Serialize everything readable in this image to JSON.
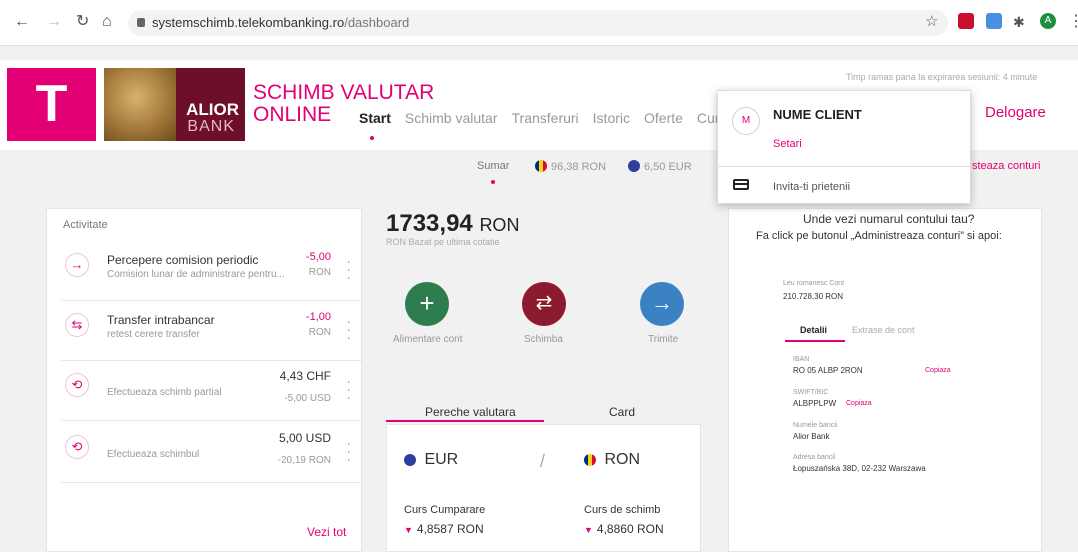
{
  "browser": {
    "url_domain": "systemschimb.telekombanking.ro",
    "url_path": "/dashboard",
    "profile_initial": "A"
  },
  "header": {
    "brand_line1": "SCHIMB VALUTAR",
    "brand_line2": "ONLINE",
    "alior_line1": "ALIOR",
    "alior_line2": "BANK",
    "session_text": "Timp ramas pana la expirarea sesiunii: 4 minute",
    "logout_label": "Delogare",
    "nav": [
      "Start",
      "Schimb valutar",
      "Transferuri",
      "Istoric",
      "Oferte",
      "Curs"
    ]
  },
  "summary": {
    "label": "Sumar",
    "ron": "96,38 RON",
    "eur": "6,50 EUR",
    "manage_link": "steaza conturi"
  },
  "activity": {
    "title": "Activitate",
    "items": [
      {
        "title": "Percepere comision periodic",
        "subtitle": "Comision lunar de administrare pentru...",
        "amount": "-5,00",
        "amount2": "RON",
        "icon": "arrow-right"
      },
      {
        "title": "Transfer intrabancar",
        "subtitle": "retest cerere transfer",
        "amount": "-1,00",
        "amount2": "RON",
        "icon": "transfer"
      },
      {
        "title": "",
        "subtitle": "Efectueaza schimb partial",
        "amount": "4,43 CHF",
        "amount2": "-5,00 USD",
        "icon": "exchange"
      },
      {
        "title": "",
        "subtitle": "Efectueaza schimbul",
        "amount": "5,00 USD",
        "amount2": "-20,19 RON",
        "icon": "exchange"
      }
    ],
    "see_all": "Vezi tot"
  },
  "balance": {
    "integer": "1733,",
    "decimal": "94",
    "currency": "RON",
    "subtitle": "RON Bazat pe ultima cotatie"
  },
  "actions": [
    {
      "label": "Alimentare cont",
      "color": "#2e7d4f",
      "icon": "+"
    },
    {
      "label": "Schimba",
      "color": "#8b1a2f",
      "icon": "⇄"
    },
    {
      "label": "Trimite",
      "color": "#3b82c4",
      "icon": "→"
    }
  ],
  "pair": {
    "tabs": [
      "Pereche valutara",
      "Card"
    ],
    "from": "EUR",
    "to": "RON",
    "separator": "/",
    "buy_label": "Curs Cumparare",
    "buy_value": "4,8587 RON",
    "rate_label": "Curs de schimb",
    "rate_value": "4,8860 RON"
  },
  "help": {
    "title": "Unde vezi numarul contului tau?",
    "text": "Fa click pe butonul „Administreaza conturi” si apoi:",
    "mock_account_label": "Leu romanesc Cont",
    "mock_account_value": "210.728,30 RON",
    "mock_tab1": "Detalii",
    "mock_tab2": "Extrase de cont",
    "iban_label": "IBAN",
    "iban_value": "RO 05 ALBP 2RON",
    "copy": "Copiaza",
    "swift_label": "SWIFT/BIC",
    "swift_value": "ALBPPLPW",
    "bank_label": "Numele bancii",
    "bank_value": "Alior Bank",
    "addr_label": "Adresa bancii",
    "addr_value": "Łopuszańska 38D, 02-232 Warszawa"
  },
  "dropdown": {
    "avatar": "M",
    "name": "NUME CLIENT",
    "settings": "Setari",
    "invite": "Invita-ti prietenii"
  }
}
